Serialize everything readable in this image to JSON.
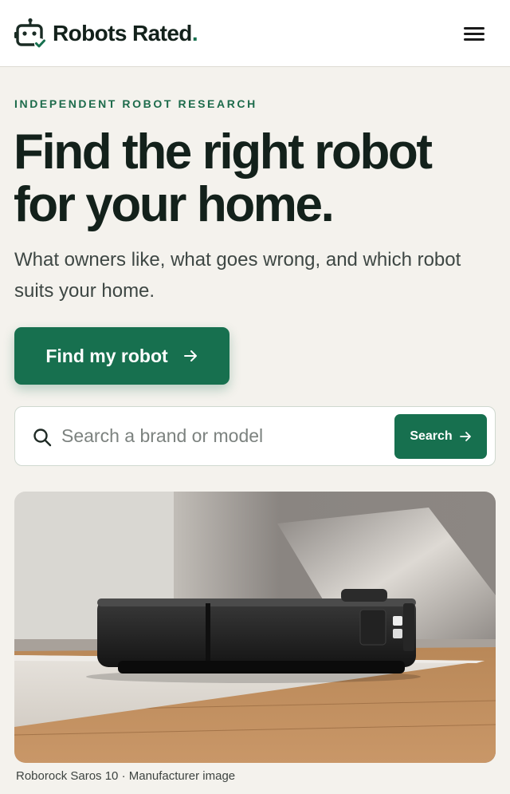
{
  "header": {
    "brand_name": "Robots Rated",
    "brand_dot": ".",
    "menu_icon": "hamburger-menu-icon",
    "logo_icon": "robot-check-icon"
  },
  "hero": {
    "eyebrow": "INDEPENDENT ROBOT RESEARCH",
    "headline": "Find the right robot for your home.",
    "subtext": "What owners like, what goes wrong, and which robot suits your home.",
    "cta_label": "Find my robot"
  },
  "search": {
    "placeholder": "Search a brand or model",
    "button_label": "Search"
  },
  "image": {
    "caption": "Roborock Saros 10 · Manufacturer image",
    "alt": "Roborock Saros 10 robot vacuum on a rug"
  },
  "colors": {
    "accent": "#17704f",
    "background": "#f4f2ed",
    "text": "#13211b"
  }
}
